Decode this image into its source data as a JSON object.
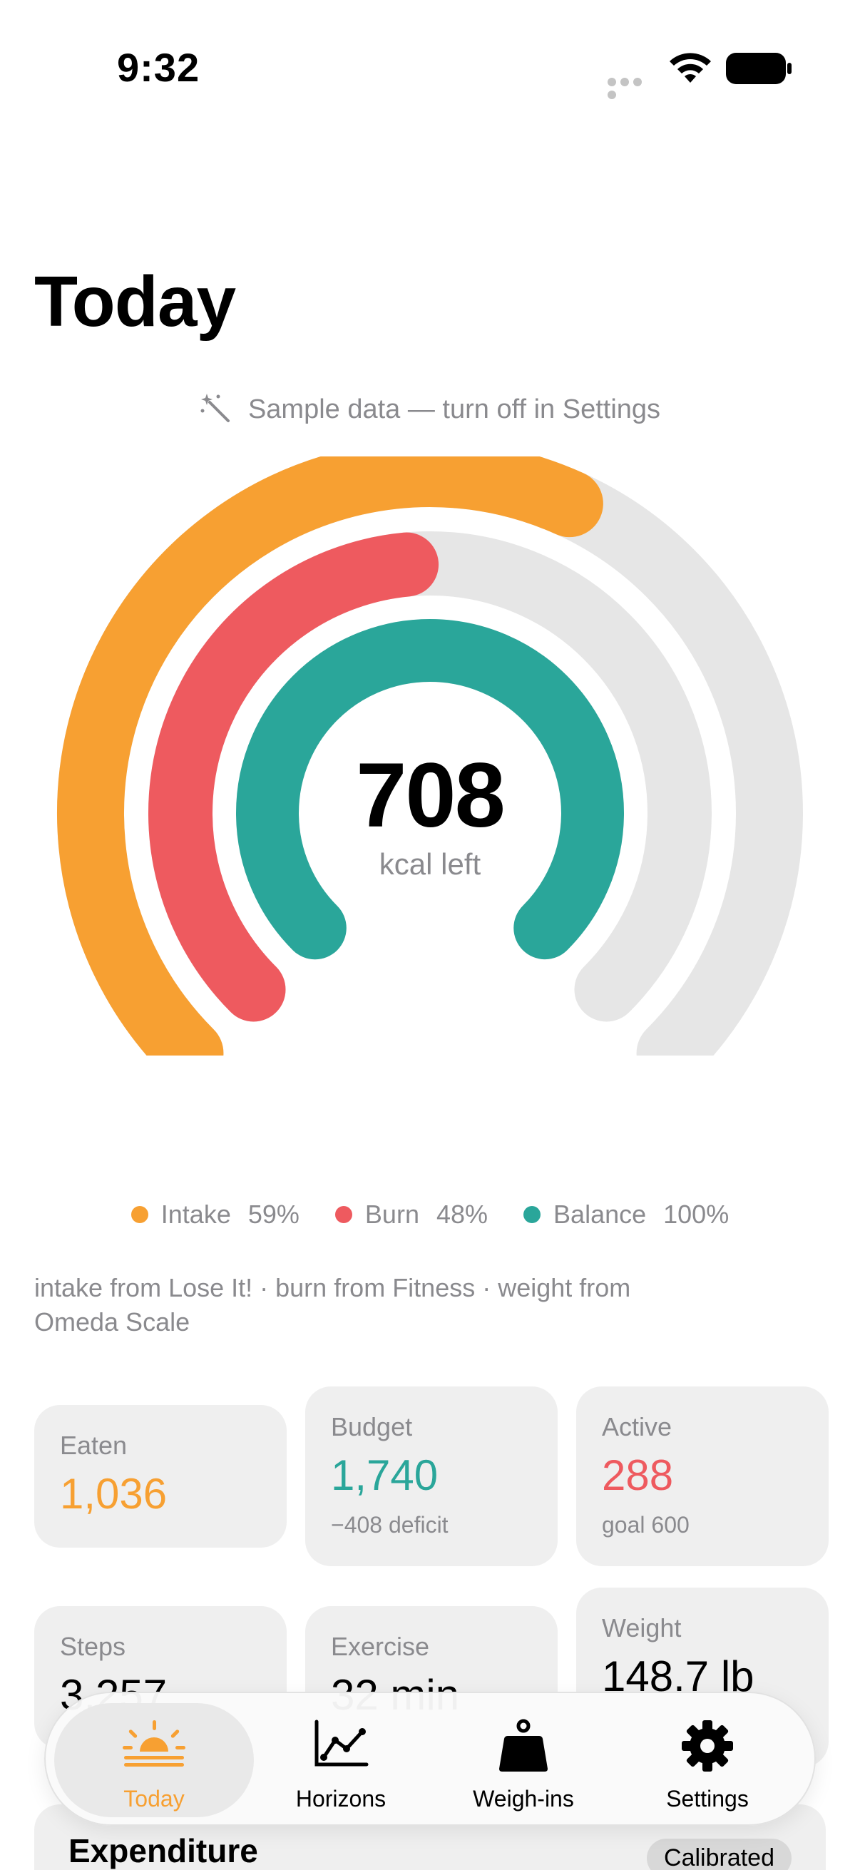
{
  "status": {
    "time": "9:32"
  },
  "header": {
    "title": "Today"
  },
  "sample_note": "Sample data — turn off in Settings",
  "summary": {
    "value": "708",
    "unit": "kcal left"
  },
  "rings": [
    {
      "name": "Intake",
      "percent": "59%",
      "fraction": 0.59,
      "color": "#f7a032"
    },
    {
      "name": "Burn",
      "percent": "48%",
      "fraction": 0.48,
      "color": "#ee5a5f"
    },
    {
      "name": "Balance",
      "percent": "100%",
      "fraction": 1.0,
      "color": "#2aa69a"
    }
  ],
  "ring_track_color": "#e6e6e6",
  "sources": "intake from Lose It! · burn from Fitness · weight from Omeda Scale",
  "cards": {
    "eaten": {
      "label": "Eaten",
      "value": "1,036"
    },
    "budget": {
      "label": "Budget",
      "value": "1,740",
      "sub": "−408 deficit"
    },
    "active": {
      "label": "Active",
      "value": "288",
      "sub": "goal 600"
    },
    "steps": {
      "label": "Steps",
      "value": "3,257"
    },
    "exercise": {
      "label": "Exercise",
      "value": "32 min"
    },
    "weight": {
      "label": "Weight",
      "value": "148.7 lb"
    }
  },
  "tabs": [
    {
      "label": "Today",
      "icon": "sunrise-icon",
      "active": true
    },
    {
      "label": "Horizons",
      "icon": "line-chart-icon",
      "active": false
    },
    {
      "label": "Weigh-ins",
      "icon": "weight-icon",
      "active": false
    },
    {
      "label": "Settings",
      "icon": "gear-icon",
      "active": false
    }
  ],
  "expenditure": {
    "title": "Expenditure",
    "badge": "Calibrated"
  },
  "colors": {
    "accent": "#f7a032",
    "teal": "#2aa69a",
    "red": "#ee5a5f"
  }
}
